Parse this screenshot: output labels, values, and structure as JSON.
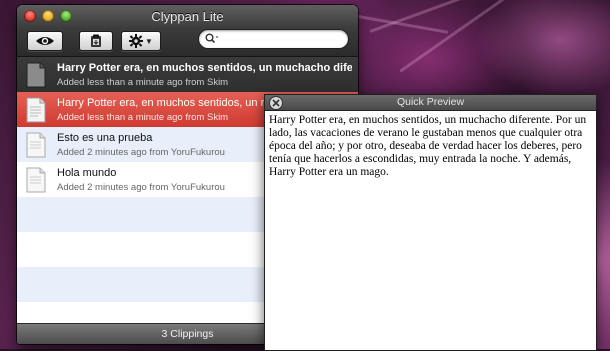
{
  "window": {
    "title": "Clyppan Lite",
    "search_placeholder": "",
    "footer": "3 Clippings"
  },
  "clippings": [
    {
      "title": "Harry Potter era, en muchos sentidos, un muchacho dife...",
      "subtitle": "Added less than a minute ago from Skim",
      "state": "pinned-dark"
    },
    {
      "title": "Harry Potter era, en muchos sentidos, un muchacho diferente. Por un lado,",
      "subtitle": "Added less than a minute ago from Skim",
      "state": "selected"
    },
    {
      "title": "Esto es una prueba",
      "subtitle": "Added 2 minutes ago from YoruFukurou",
      "state": "normal"
    },
    {
      "title": "Hola mundo",
      "subtitle": "Added 2 minutes ago from YoruFukurou",
      "state": "normal"
    }
  ],
  "quick_preview": {
    "title": "Quick Preview",
    "body": "Harry Potter era, en muchos sentidos, un muchacho diferente. Por un lado, las vacaciones de verano le gustaban menos que cualquier otra época del año; y por otro, deseaba de verdad hacer los deberes, pero tenía que hacerlos a escondidas, muy entrada la noche. Y además, Harry Potter era un mago."
  },
  "colors": {
    "selected_row": "#dc4a40",
    "dark_row": "#353535",
    "stripe": "#e8eefa"
  },
  "icons": [
    "eye-icon",
    "paste-icon",
    "gear-icon",
    "search-icon",
    "document-icon",
    "close-icon"
  ]
}
